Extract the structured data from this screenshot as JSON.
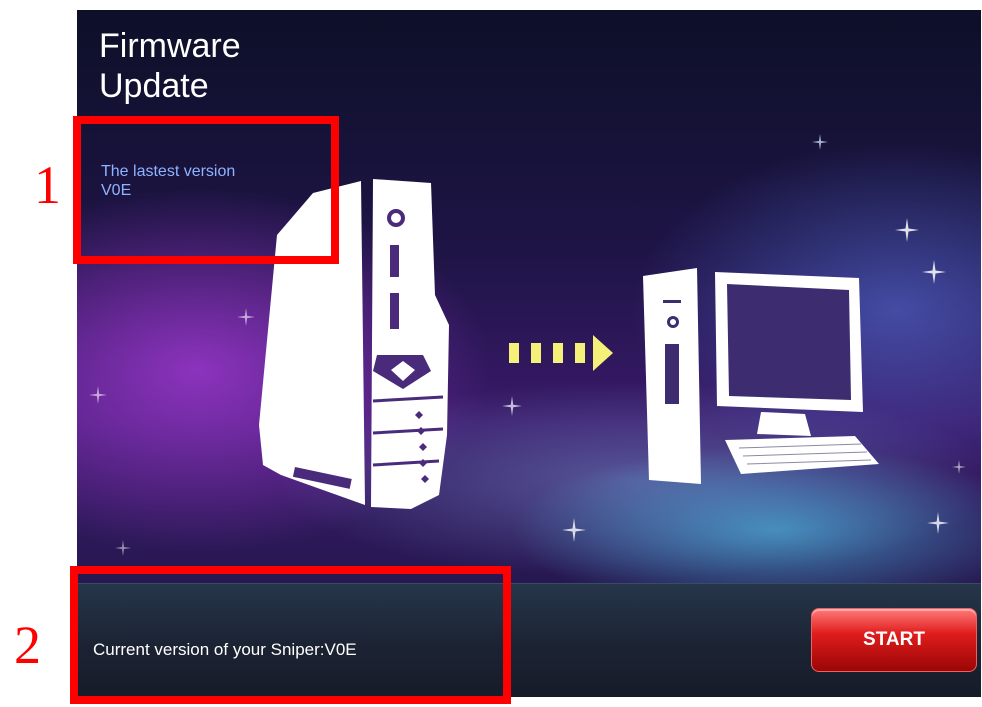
{
  "screen": {
    "title_line1": "Firmware",
    "title_line2": "Update",
    "latest_label": "The lastest version",
    "latest_value": "V0E",
    "current_version_text": "Current version of your Sniper:V0E",
    "start_label": "START"
  },
  "annotations": {
    "callout_1": "1",
    "callout_2": "2"
  },
  "icons": {
    "device": "tower-device-icon",
    "arrow": "arrow-right-icon",
    "computer": "desktop-computer-icon"
  },
  "colors": {
    "accent": "#e01c1c",
    "latest_text": "#8fb4ff",
    "callout": "#ff0000"
  }
}
